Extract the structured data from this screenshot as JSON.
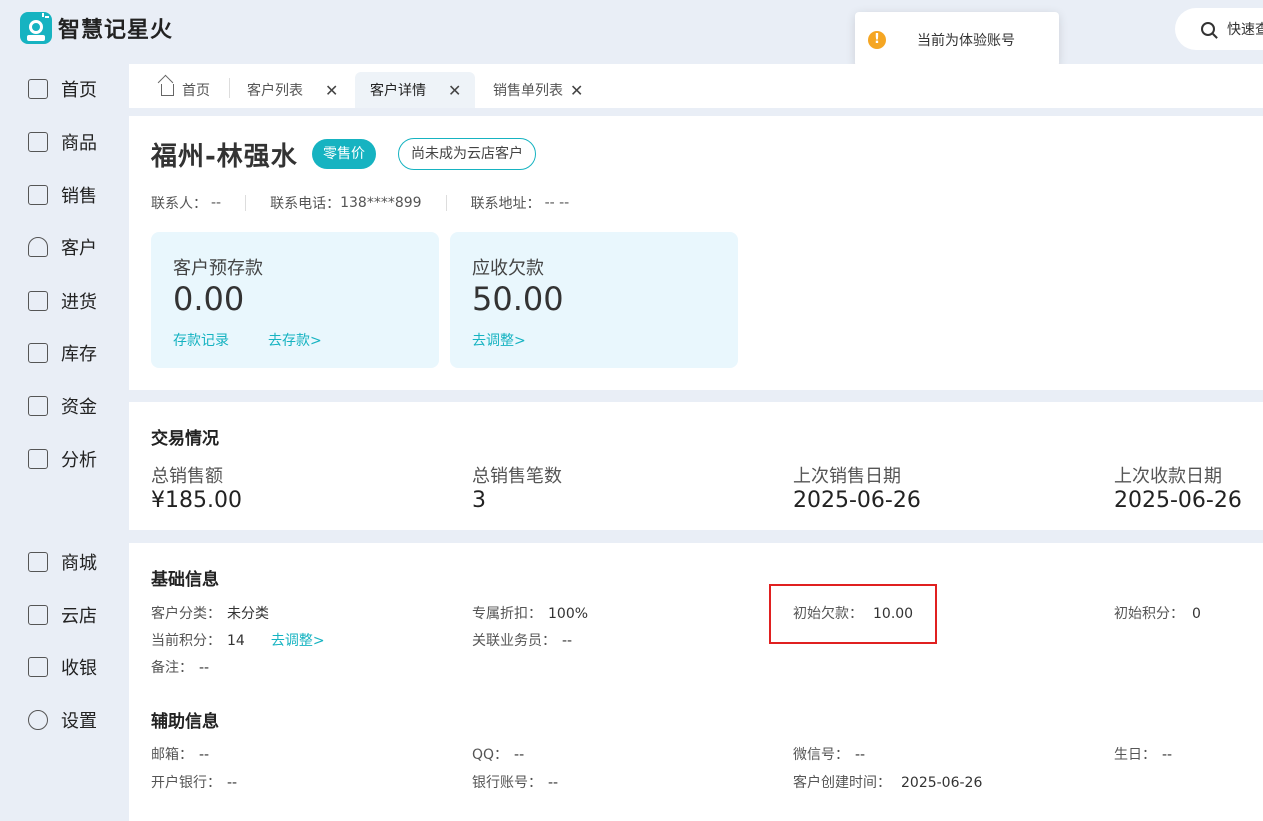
{
  "app": {
    "title": "智慧记星火"
  },
  "toast": {
    "message": "当前为体验账号"
  },
  "quick_search": {
    "label": "快速查找"
  },
  "sidebar": {
    "items": [
      {
        "label": "首页",
        "icon": "home-icon"
      },
      {
        "label": "商品",
        "icon": "bag-icon"
      },
      {
        "label": "销售",
        "icon": "clipboard-icon"
      },
      {
        "label": "客户",
        "icon": "user-icon"
      },
      {
        "label": "进货",
        "icon": "purchase-icon"
      },
      {
        "label": "库存",
        "icon": "warehouse-icon"
      },
      {
        "label": "资金",
        "icon": "wallet-icon"
      },
      {
        "label": "分析",
        "icon": "chart-icon"
      },
      {
        "label": "商城",
        "icon": "store-icon"
      },
      {
        "label": "云店",
        "icon": "cloud-store-icon"
      },
      {
        "label": "收银",
        "icon": "cashier-icon"
      },
      {
        "label": "设置",
        "icon": "gear-icon"
      }
    ]
  },
  "tabs": [
    {
      "label": "首页",
      "closable": false
    },
    {
      "label": "客户列表",
      "closable": true
    },
    {
      "label": "客户详情",
      "closable": true,
      "active": true
    },
    {
      "label": "销售单列表",
      "closable": true
    }
  ],
  "customer": {
    "name": "福州-林强水",
    "price_badge": "零售价",
    "cloud_badge": "尚未成为云店客户",
    "contact_label": "联系人：",
    "contact_value": "--",
    "phone_label": "联系电话：",
    "phone_value": "138****899",
    "address_label": "联系地址：",
    "address_value": "-- --"
  },
  "deposit": {
    "label": "客户预存款",
    "value": "0.00",
    "link_record": "存款记录",
    "link_deposit": "去存款>"
  },
  "receivable": {
    "label": "应收欠款",
    "value": "50.00",
    "link_adjust": "去调整>"
  },
  "transactions": {
    "title": "交易情况",
    "total_sales_label": "总销售额",
    "total_sales_value": "¥185.00",
    "count_label": "总销售笔数",
    "count_value": "3",
    "last_sale_label": "上次销售日期",
    "last_sale_value": "2025-06-26",
    "last_receipt_label": "上次收款日期",
    "last_receipt_value": "2025-06-26"
  },
  "basic": {
    "title": "基础信息",
    "category_label": "客户分类：",
    "category_value": "未分类",
    "discount_label": "专属折扣：",
    "discount_value": "100%",
    "init_debt_label": "初始欠款：",
    "init_debt_value": "10.00",
    "init_points_label": "初始积分：",
    "init_points_value": "0",
    "points_label": "当前积分：",
    "points_value": "14",
    "points_link": "去调整>",
    "staff_label": "关联业务员：",
    "staff_value": "--",
    "remark_label": "备注：",
    "remark_value": "--"
  },
  "aux": {
    "title": "辅助信息",
    "email_label": "邮箱：",
    "email_value": "--",
    "qq_label": "QQ：",
    "qq_value": "--",
    "wechat_label": "微信号：",
    "wechat_value": "--",
    "birthday_label": "生日：",
    "birthday_value": "--",
    "bank_label": "开户银行：",
    "bank_value": "--",
    "account_label": "银行账号：",
    "account_value": "--",
    "created_label": "客户创建时间：",
    "created_value": "2025-06-26"
  }
}
